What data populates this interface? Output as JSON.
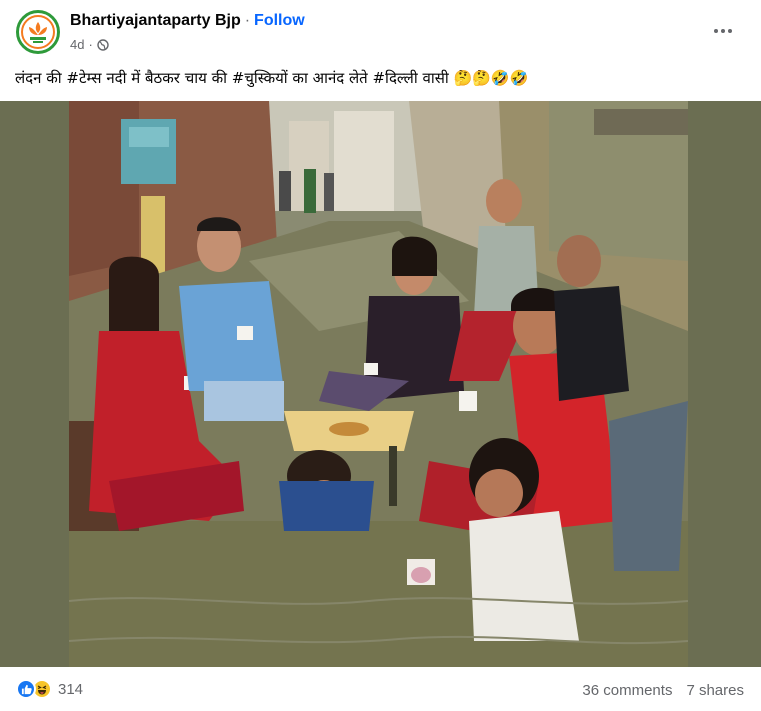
{
  "post": {
    "author": "Bhartiyajantaparty Bjp",
    "separator": "·",
    "follow_label": "Follow",
    "time": "4d",
    "visibility_icon": "globe-icon",
    "more_icon": "more-horizontal-icon",
    "caption": "लंदन की #टेम्स नदी में बैठकर चाय की #चुस्कियों का आनंद लेते #दिल्ली वासी 🤔🤔🤣🤣"
  },
  "reactions": {
    "icons": [
      "like-icon",
      "haha-icon"
    ],
    "count": "314"
  },
  "stats": {
    "comments": "36 comments",
    "shares": "7 shares"
  },
  "colors": {
    "link": "#0866ff",
    "secondary_text": "#65676b",
    "photo_letterbox": "#6b6e52",
    "water": "#7a7a5a"
  }
}
